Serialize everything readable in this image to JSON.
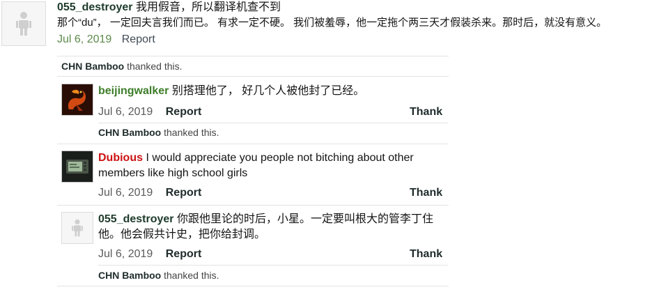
{
  "top_post": {
    "username": "055_destroyer",
    "text_line1": "我用假音，所以翻译机查不到",
    "text_line2": "那个“du”， 一定回夫言我们而已。 有求一定不硬。 我们被羞辱，他一定拖个两三天才假装杀来。那时后，就没有意义。",
    "date": "Jul 6, 2019",
    "report_label": "Report",
    "thanks_user": "CHN Bamboo",
    "thanks_suffix": "thanked this."
  },
  "replies": [
    {
      "username": "beijingwalker",
      "text": "别搭理他了， 好几个人被他封了已经。",
      "date": "Jul 6, 2019",
      "report_label": "Report",
      "thank_label": "Thank",
      "thanks_user": "CHN Bamboo",
      "thanks_suffix": "thanked this."
    },
    {
      "username": "Dubious",
      "text_line1": "I would appreciate you people not bitching about other",
      "text_line2": "members like high school girls",
      "date": "Jul 6, 2019",
      "report_label": "Report",
      "thank_label": "Thank"
    },
    {
      "username": "055_destroyer",
      "text_line1": "你跟他里论的时后，小星。一定要叫根大的管李丁住",
      "text_line2": "他。他会假共计史，把你给封调。",
      "date": "Jul 6, 2019",
      "report_label": "Report",
      "thank_label": "Thank",
      "thanks_user": "CHN Bamboo",
      "thanks_suffix": "thanked this."
    }
  ],
  "colors": {
    "username": "#1d3a2a",
    "username_green": "#3d7d29",
    "username_red": "#cc1111",
    "date_green": "#5b8a4a"
  }
}
